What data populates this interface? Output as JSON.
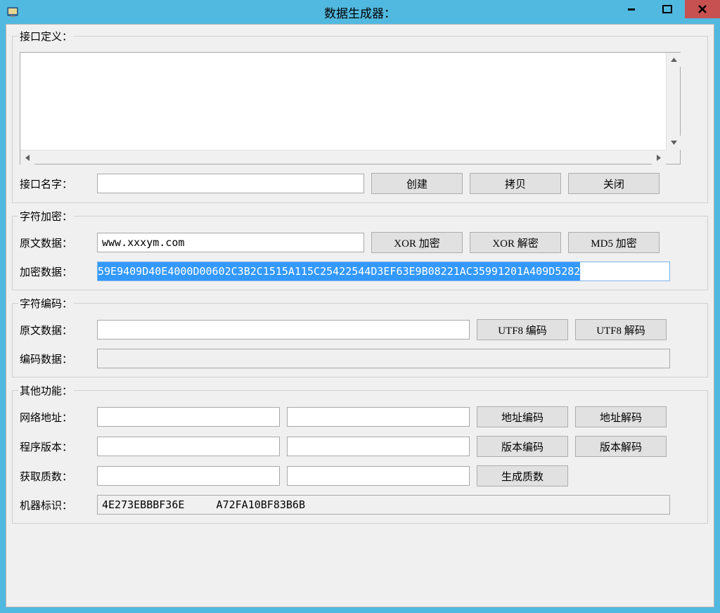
{
  "title": "数据生成器：",
  "sections": {
    "interface_def": {
      "legend": "接口定义：",
      "name_label": "接口名字：",
      "name_value": "",
      "btn_create": "创建",
      "btn_copy": "拷贝",
      "btn_close": "关闭"
    },
    "str_encrypt": {
      "legend": "字符加密：",
      "plain_label": "原文数据：",
      "plain_value": "www.xxxym.com",
      "enc_label": "加密数据：",
      "enc_value": "59E9409D40E4000D00602C3B2C1515A115C25422544D3EF63E9B08221AC35991201A409D5282",
      "btn_xor_enc": "XOR 加密",
      "btn_xor_dec": "XOR 解密",
      "btn_md5": "MD5 加密"
    },
    "str_encode": {
      "legend": "字符编码：",
      "plain_label": "原文数据：",
      "plain_value": "",
      "enc_label": "编码数据：",
      "enc_value": "",
      "btn_utf8_enc": "UTF8 编码",
      "btn_utf8_dec": "UTF8 解码"
    },
    "other": {
      "legend": "其他功能：",
      "net_label": "网络地址：",
      "net_val1": "",
      "net_val2": "",
      "btn_addr_enc": "地址编码",
      "btn_addr_dec": "地址解码",
      "ver_label": "程序版本：",
      "ver_val1": "",
      "ver_val2": "",
      "btn_ver_enc": "版本编码",
      "btn_ver_dec": "版本解码",
      "prime_label": "获取质数：",
      "prime_val1": "",
      "prime_val2": "",
      "btn_prime": "生成质数",
      "mach_label": "机器标识：",
      "mach_value": "4E273EBBBF36E     A72FA10BF83B6B"
    }
  }
}
